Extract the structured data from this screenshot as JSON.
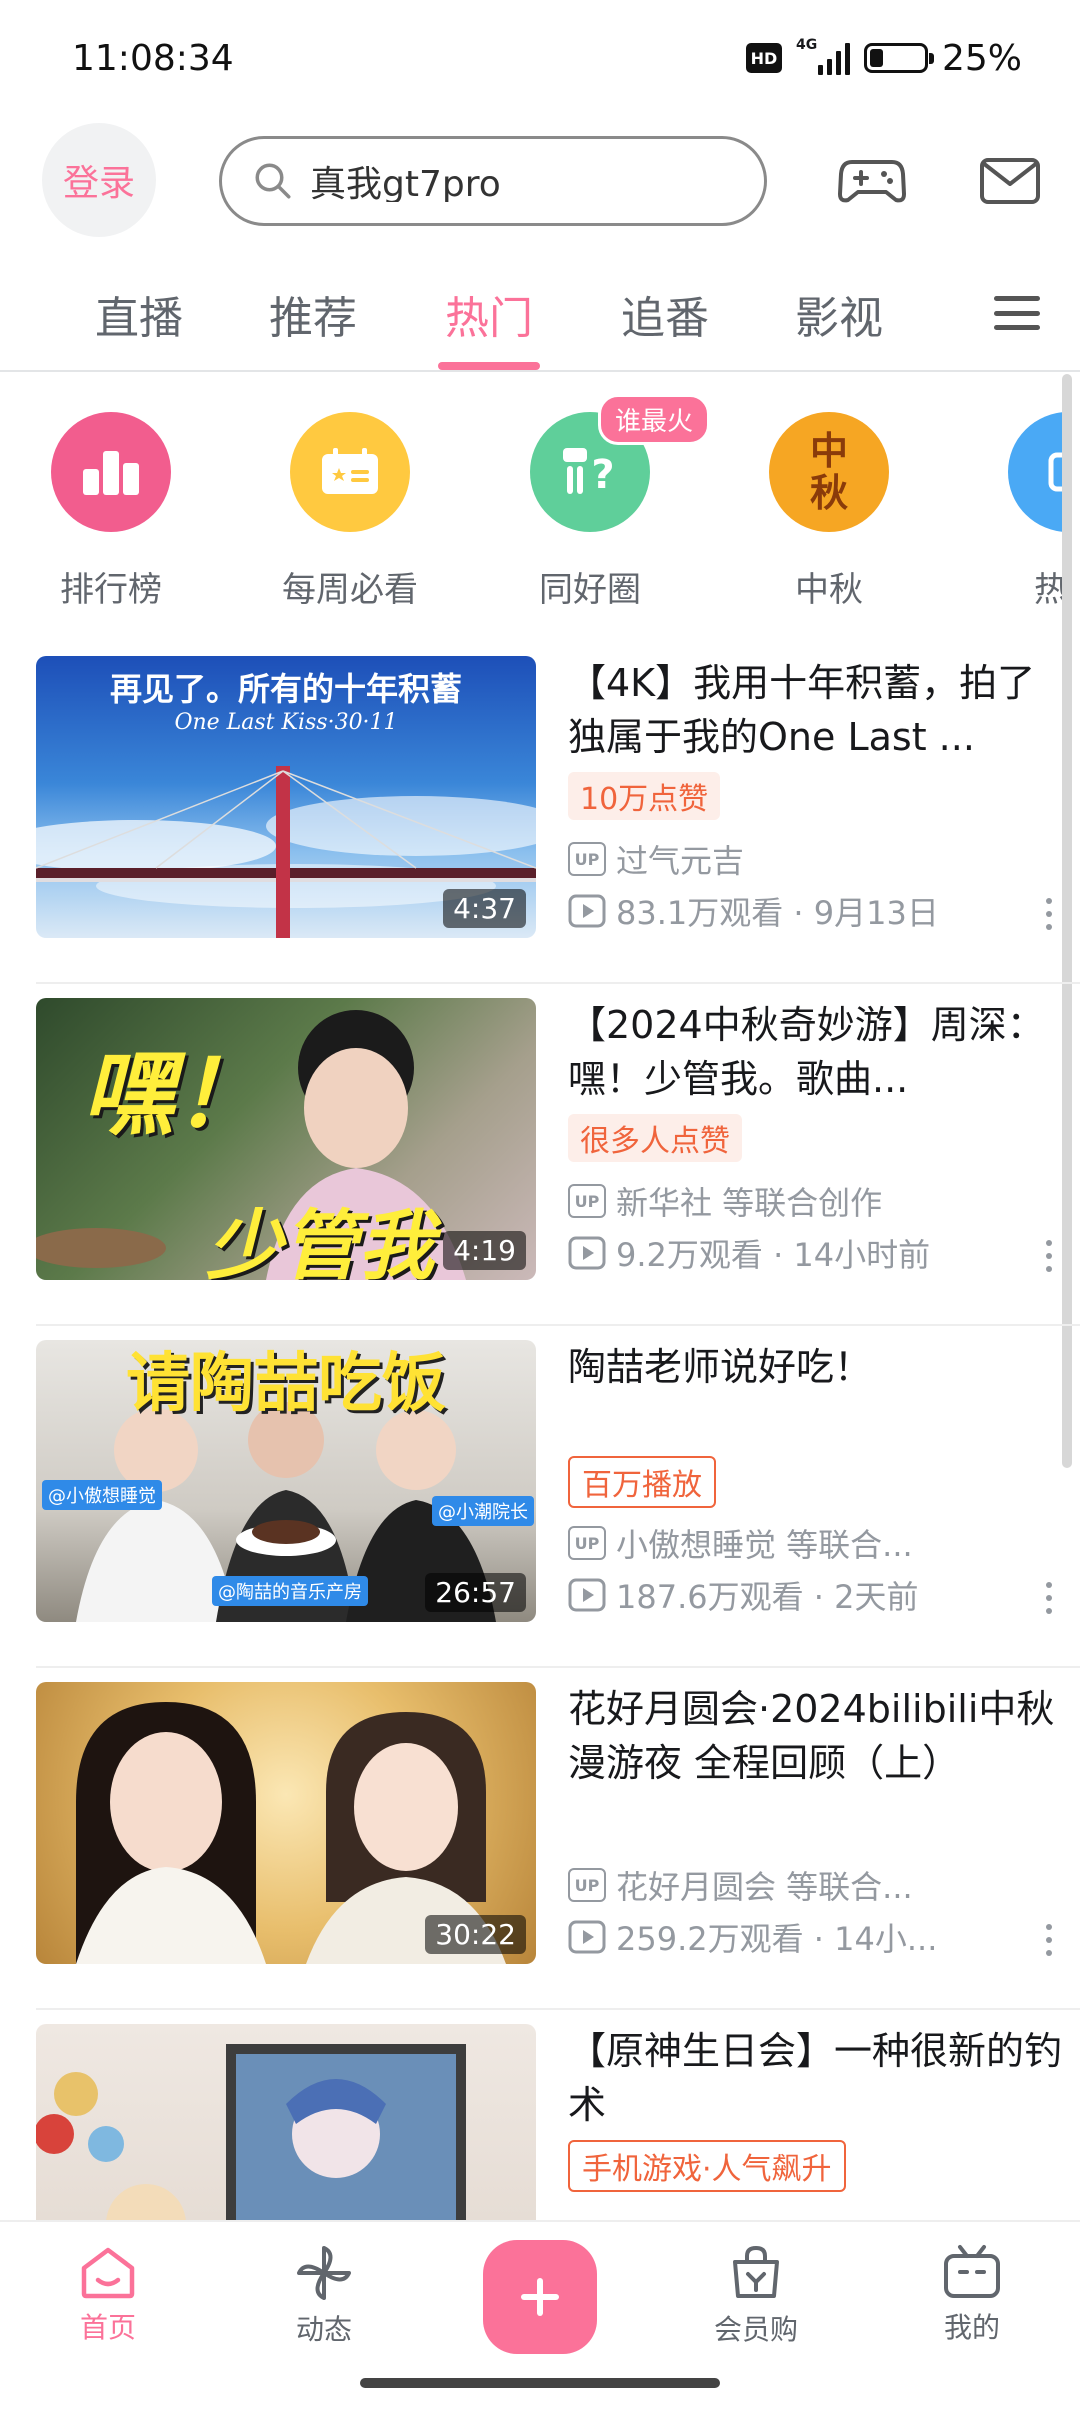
{
  "status": {
    "time": "11:08:34",
    "hd": "HD",
    "network": "4G",
    "battery_text": "25%",
    "battery_level": 0.25
  },
  "header": {
    "login": "登录",
    "search_value": "真我gt7pro"
  },
  "tabs": [
    {
      "label": "直播"
    },
    {
      "label": "推荐"
    },
    {
      "label": "热门",
      "active": true
    },
    {
      "label": "追番"
    },
    {
      "label": "影视"
    }
  ],
  "categories": [
    {
      "label": "排行榜",
      "color": "#f25d8e",
      "icon": "ranking-icon"
    },
    {
      "label": "每周必看",
      "color": "#ffc940",
      "icon": "weekly-icon"
    },
    {
      "label": "同好圈",
      "color": "#5fcf9a",
      "icon": "group-icon",
      "badge": "谁最火"
    },
    {
      "label": "中秋",
      "color": "#f6a623",
      "icon": "mid-autumn-icon",
      "icon_text": "中秋"
    },
    {
      "label": "热点",
      "color": "#4aa9f5",
      "icon": "hotspot-icon"
    }
  ],
  "feed": [
    {
      "title": "【4K】我用十年积蓄，拍了独属于我的One Last ...",
      "duration": "4:37",
      "badge": "10万点赞",
      "badge_style": "fill",
      "up": "过气元吉",
      "stats": "83.1万观看 · 9月13日",
      "thumb_caption": "再见了。所有的十年积蓄",
      "thumb_sub": "One Last Kiss·30·11"
    },
    {
      "title": "【2024中秋奇妙游】周深：嘿！少管我。歌曲...",
      "duration": "4:19",
      "badge": "很多人点赞",
      "badge_style": "fill",
      "up": "新华社 等联合创作",
      "stats": "9.2万观看 · 14小时前",
      "thumb_caption": "嘿！",
      "thumb_sub": "少管我"
    },
    {
      "title": "陶喆老师说好吃！",
      "duration": "26:57",
      "badge": "百万播放",
      "badge_style": "outline",
      "up": "小傲想睡觉 等联合...",
      "stats": "187.6万观看 · 2天前",
      "thumb_caption": "请陶喆吃饭",
      "thumb_tags": [
        "@小傲想睡觉",
        "@小潮院长",
        "@陶喆的音乐产房"
      ]
    },
    {
      "title": "花好月圆会·2024bilibili中秋漫游夜 全程回顾（上）",
      "duration": "30:22",
      "badge": "",
      "badge_style": "",
      "up": "花好月圆会 等联合...",
      "stats": "259.2万观看 · 14小..."
    },
    {
      "title": "【原神生日会】一种很新的钓术",
      "duration": "",
      "badge": "手机游戏·人气飙升",
      "badge_style": "outline",
      "up": "",
      "stats": ""
    }
  ],
  "bottom_nav": [
    {
      "label": "首页",
      "icon": "home-icon",
      "active": true
    },
    {
      "label": "动态",
      "icon": "windmill-icon"
    },
    {
      "label": "",
      "icon": "plus-icon"
    },
    {
      "label": "会员购",
      "icon": "shopping-bag-icon"
    },
    {
      "label": "我的",
      "icon": "tv-profile-icon"
    }
  ],
  "colors": {
    "accent": "#fb7299",
    "badge_orange": "#f0643c",
    "meta_gray": "#9499a0"
  }
}
